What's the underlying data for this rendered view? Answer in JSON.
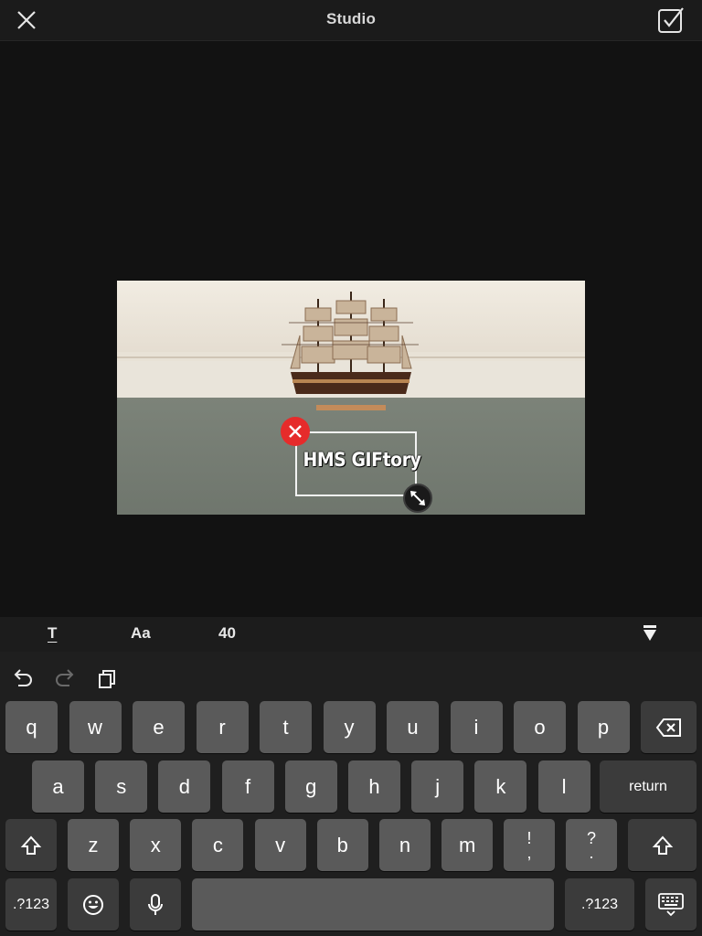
{
  "navbar": {
    "title": "Studio",
    "close_icon": "close-icon",
    "done_icon": "checkbox-check-icon"
  },
  "overlay": {
    "text": "HMS GIFtory",
    "delete_icon": "close-icon",
    "resize_icon": "resize-diagonal-icon"
  },
  "text_toolbar": {
    "font_label": "T",
    "style_label": "Aa",
    "size_label": "40",
    "collapse_icon": "triangle-down-icon"
  },
  "keyboard": {
    "shortcuts": [
      "undo-icon",
      "redo-icon",
      "paste-icon"
    ],
    "row1": [
      "q",
      "w",
      "e",
      "r",
      "t",
      "y",
      "u",
      "i",
      "o",
      "p"
    ],
    "row2": [
      "a",
      "s",
      "d",
      "f",
      "g",
      "h",
      "j",
      "k",
      "l"
    ],
    "row3": [
      "z",
      "x",
      "c",
      "v",
      "b",
      "n",
      "m"
    ],
    "punct1": {
      "top": "!",
      "bottom": ","
    },
    "punct2": {
      "top": "?",
      "bottom": "."
    },
    "return_label": "return",
    "numbers_label": ".?123",
    "colors": {
      "key": "#5a5a5a",
      "special_key": "#3b3b3b",
      "background": "#1f1f1f"
    }
  }
}
